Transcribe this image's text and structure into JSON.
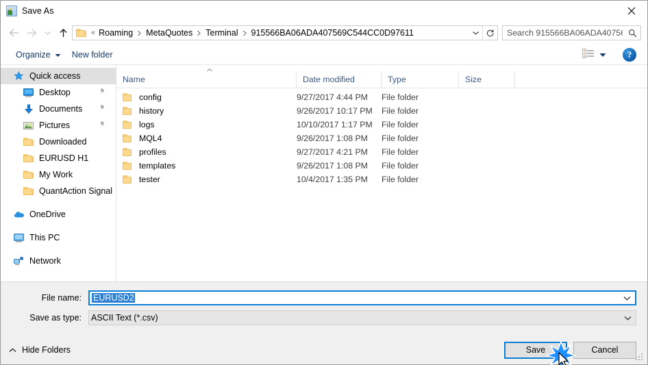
{
  "window": {
    "title": "Save As",
    "icon": "save-as-app-icon",
    "close_label": "✕"
  },
  "nav": {
    "back": "←",
    "forward": "→",
    "recent_dropdown": "⌄",
    "up": "↑",
    "breadcrumb_prefix": "«",
    "breadcrumbs": [
      "Roaming",
      "MetaQuotes",
      "Terminal",
      "915566BA06ADA407569C544CC0D97611"
    ],
    "address_dropdown": "⌄",
    "refresh": "⟳"
  },
  "search": {
    "placeholder": "Search 915566BA06ADA40756...",
    "value": "",
    "icon": "search-icon"
  },
  "commandbar": {
    "organize_label": "Organize",
    "new_folder_label": "New folder",
    "view_icon": "view-layout-icon",
    "view_dropdown": "▼",
    "help_label": "?"
  },
  "sidebar": {
    "items": [
      {
        "label": "Quick access",
        "icon": "quick-access-star-icon",
        "selected": true,
        "indent": "root",
        "pinned": false
      },
      {
        "label": "Desktop",
        "icon": "desktop-icon",
        "selected": false,
        "indent": "child",
        "pinned": true
      },
      {
        "label": "Documents",
        "icon": "documents-icon",
        "selected": false,
        "indent": "child",
        "pinned": true
      },
      {
        "label": "Pictures",
        "icon": "pictures-icon",
        "selected": false,
        "indent": "child",
        "pinned": true
      },
      {
        "label": "Downloaded",
        "icon": "folder-icon",
        "selected": false,
        "indent": "child",
        "pinned": false
      },
      {
        "label": "EURUSD H1",
        "icon": "folder-icon",
        "selected": false,
        "indent": "child",
        "pinned": false
      },
      {
        "label": "My Work",
        "icon": "folder-icon",
        "selected": false,
        "indent": "child",
        "pinned": false
      },
      {
        "label": "QuantAction Signal",
        "icon": "folder-icon",
        "selected": false,
        "indent": "child",
        "pinned": false
      },
      {
        "label": "OneDrive",
        "icon": "onedrive-cloud-icon",
        "selected": false,
        "indent": "root",
        "pinned": false,
        "gap_before": true
      },
      {
        "label": "This PC",
        "icon": "this-pc-icon",
        "selected": false,
        "indent": "root",
        "pinned": false,
        "gap_before": true
      },
      {
        "label": "Network",
        "icon": "network-icon",
        "selected": false,
        "indent": "root",
        "pinned": false,
        "gap_before": true
      }
    ]
  },
  "filelist": {
    "sort_indicator": "ascending",
    "columns": [
      "Name",
      "Date modified",
      "Type",
      "Size"
    ],
    "rows": [
      {
        "name": "config",
        "date": "9/27/2017 4:44 PM",
        "type": "File folder",
        "size": ""
      },
      {
        "name": "history",
        "date": "9/26/2017 10:17 PM",
        "type": "File folder",
        "size": ""
      },
      {
        "name": "logs",
        "date": "10/10/2017 1:17 PM",
        "type": "File folder",
        "size": ""
      },
      {
        "name": "MQL4",
        "date": "9/26/2017 1:08 PM",
        "type": "File folder",
        "size": ""
      },
      {
        "name": "profiles",
        "date": "9/27/2017 4:21 PM",
        "type": "File folder",
        "size": ""
      },
      {
        "name": "templates",
        "date": "9/26/2017 1:08 PM",
        "type": "File folder",
        "size": ""
      },
      {
        "name": "tester",
        "date": "10/4/2017 1:35 PM",
        "type": "File folder",
        "size": ""
      }
    ]
  },
  "form": {
    "filename_label": "File name:",
    "filename_value": "EURUSD2",
    "filename_selected": true,
    "filetype_label": "Save as type:",
    "filetype_value": "ASCII Text (*.csv)",
    "dropdown_glyph": "⌄"
  },
  "footer": {
    "hide_folders_label": "Hide Folders",
    "hide_folders_chevron": "⌃",
    "save_label": "Save",
    "cancel_label": "Cancel",
    "save_is_default": true
  },
  "colors": {
    "accent_blue": "#0a7fd4",
    "selection_blue": "#2d7fd4",
    "folder_yellow": "#fcd98c",
    "header_text": "#3c5a82",
    "command_text": "#1a3a6b",
    "dialog_bg": "#f0f0f0"
  }
}
